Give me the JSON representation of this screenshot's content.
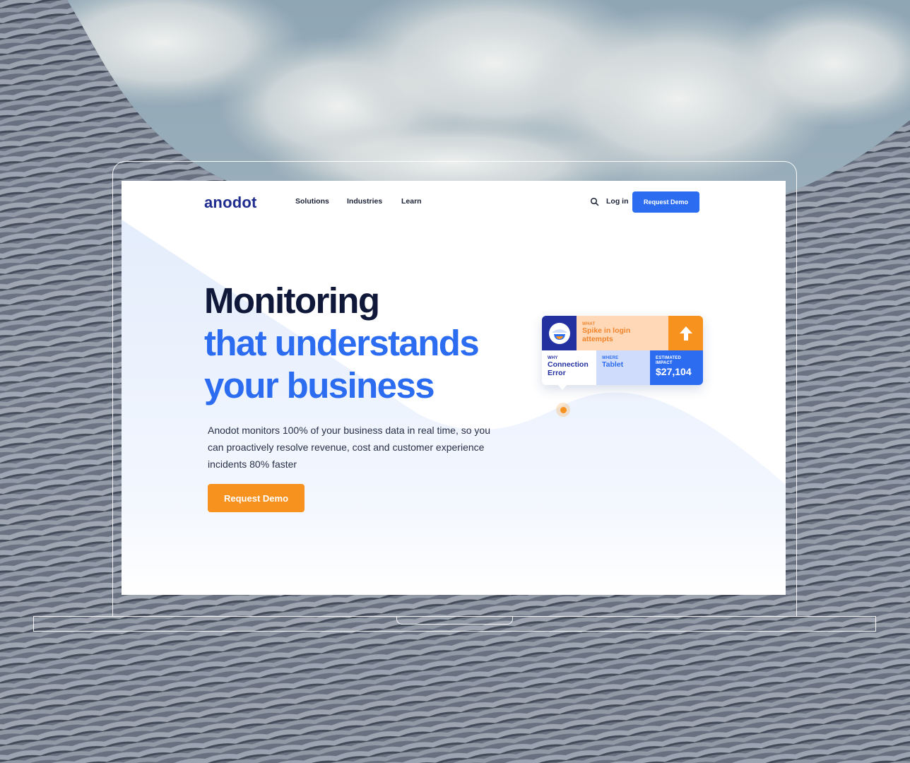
{
  "nav": {
    "logo": "anodot",
    "links": [
      "Solutions",
      "Industries",
      "Learn"
    ],
    "login": "Log in",
    "cta": "Request Demo"
  },
  "hero": {
    "title_line1": "Monitoring",
    "title_line2": "that understands",
    "title_line3": "your business",
    "description": "Anodot monitors 100% of your business data in real time, so you can proactively resolve revenue, cost and customer experience incidents 80% faster",
    "cta": "Request Demo"
  },
  "insight_card": {
    "what_label": "WHAT",
    "what_value": "Spike in login attempts",
    "why_label": "WHY",
    "why_value": "Connection Error",
    "where_label": "WHERE",
    "where_value": "Tablet",
    "impact_label": "ESTIMATED IMPACT",
    "impact_value": "$27,104"
  },
  "colors": {
    "brand_navy": "#1e2b8f",
    "brand_blue": "#2b6cf0",
    "brand_orange": "#f8921f",
    "title_dark": "#10183a"
  },
  "icons": [
    "search-icon",
    "alert-face-icon",
    "arrow-up-icon"
  ]
}
